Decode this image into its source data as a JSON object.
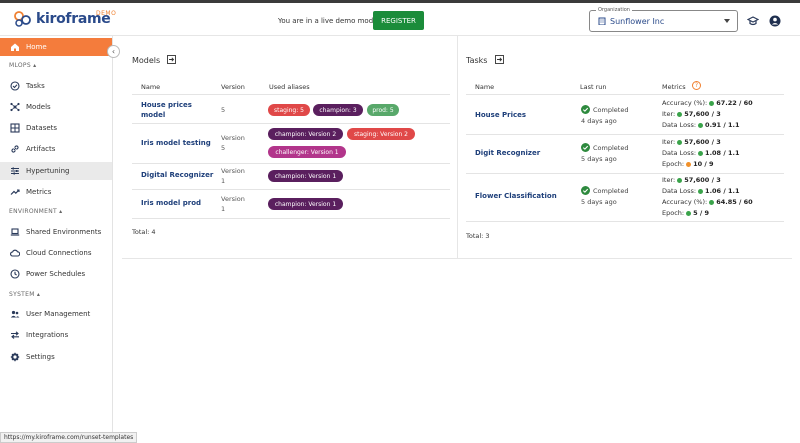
{
  "brand": {
    "logo_text": "kiroframe",
    "demo_badge": "DEMO"
  },
  "header": {
    "demo_message": "You are in a live demo mode",
    "register_label": "REGISTER",
    "organization_label": "Organization",
    "organization_value": "Sunflower Inc"
  },
  "sidebar": {
    "home": "Home",
    "sections": {
      "mlops": "MLOPS ▴",
      "environment": "ENVIRONMENT ▴",
      "system": "SYSTEM ▴"
    },
    "mlops_items": [
      "Tasks",
      "Models",
      "Datasets",
      "Artifacts",
      "Hypertuning",
      "Metrics"
    ],
    "environment_items": [
      "Shared Environments",
      "Cloud Connections",
      "Power Schedules"
    ],
    "system_items": [
      "User Management",
      "Integrations",
      "Settings"
    ]
  },
  "models": {
    "title": "Models",
    "columns": [
      "Name",
      "Version",
      "Used aliases"
    ],
    "rows": [
      {
        "name_line1": "House prices",
        "name_line2": "model",
        "version_line1": "5",
        "version_line2": "",
        "aliases": [
          "staging: 5",
          "champion: 3",
          "prod: 5"
        ]
      },
      {
        "name_line1": "Iris model testing",
        "name_line2": "",
        "version_line1": "Version",
        "version_line2": "5",
        "aliases": [
          "champion: Version 2",
          "staging: Version 2",
          "challenger: Version 1"
        ]
      },
      {
        "name_line1": "Digital Recognizer",
        "name_line2": "",
        "version_line1": "Version",
        "version_line2": "1",
        "aliases": [
          "champion: Version 1"
        ]
      },
      {
        "name_line1": "Iris model prod",
        "name_line2": "",
        "version_line1": "Version",
        "version_line2": "1",
        "aliases": [
          "champion: Version 1"
        ]
      }
    ],
    "total": "Total: 4"
  },
  "tasks": {
    "title": "Tasks",
    "columns": [
      "Name",
      "Last run",
      "Metrics"
    ],
    "rows": [
      {
        "name": "House Prices",
        "status": "Completed",
        "when": "4 days ago",
        "metrics": [
          {
            "label": "Accuracy (%):",
            "dot": "green",
            "value": "67.22 / 60"
          },
          {
            "label": "Iter:",
            "dot": "green",
            "value": "57,600 / 3"
          },
          {
            "label": "Data Loss:",
            "dot": "green",
            "value": "0.91 / 1.1"
          }
        ]
      },
      {
        "name": "Digit Recognizer",
        "status": "Completed",
        "when": "5 days ago",
        "metrics": [
          {
            "label": "Iter:",
            "dot": "green",
            "value": "57,600 / 3"
          },
          {
            "label": "Data Loss:",
            "dot": "green",
            "value": "1.08 / 1.1"
          },
          {
            "label": "Epoch:",
            "dot": "orange",
            "value": "10 / 9"
          }
        ]
      },
      {
        "name": "Flower Classification",
        "status": "Completed",
        "when": "5 days ago",
        "metrics": [
          {
            "label": "Iter:",
            "dot": "green",
            "value": "57,600 / 3"
          },
          {
            "label": "Data Loss:",
            "dot": "green",
            "value": "1.06 / 1.1"
          },
          {
            "label": "Accuracy (%):",
            "dot": "green",
            "value": "64.85 / 60"
          },
          {
            "label": "Epoch:",
            "dot": "green",
            "value": "5 / 9"
          }
        ]
      }
    ],
    "total": "Total: 3"
  },
  "status_bar_url": "https://my.kiroframe.com/runset-templates",
  "colors": {
    "accent": "#f47c3c",
    "brand": "#2a4a8a",
    "register": "#1b8c3a",
    "chip_red": "#e04848",
    "chip_purple": "#5a1f5e",
    "chip_magenta": "#b2358b",
    "chip_green": "#58a86a"
  }
}
